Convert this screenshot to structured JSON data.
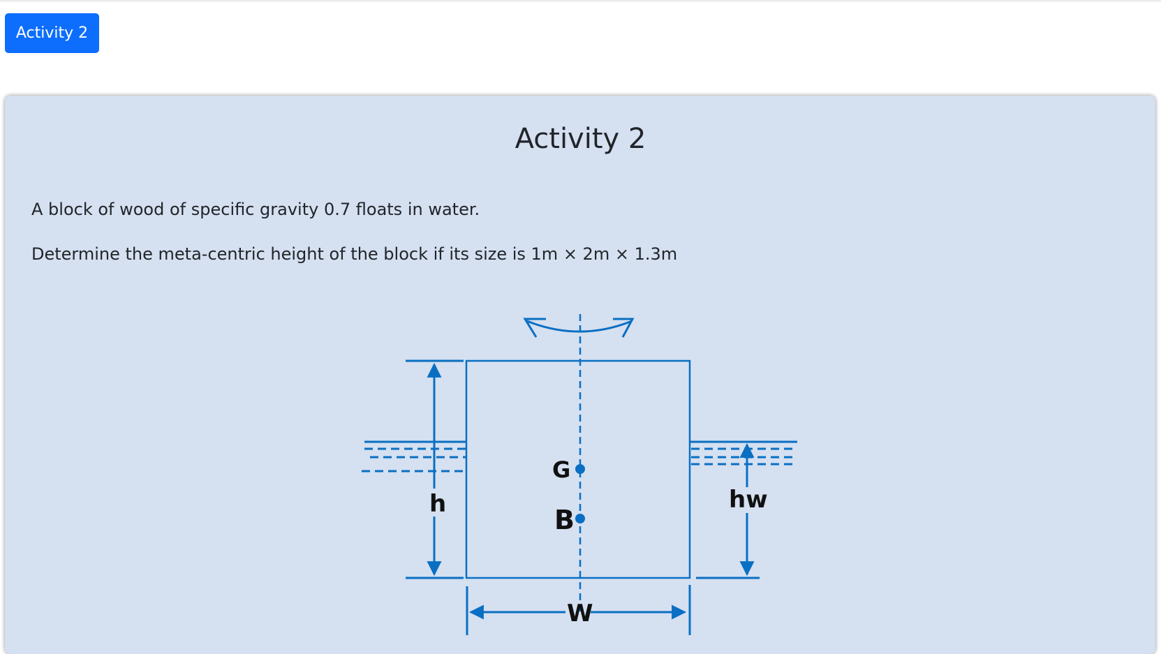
{
  "tab": {
    "label": "Activity 2"
  },
  "card": {
    "title": "Activity 2",
    "paragraphs": [
      "A block of wood of specific gravity 0.7 floats in water.",
      "Determine the meta-centric height of the block if its size is 1m × 2m × 1.3m"
    ]
  },
  "diagram": {
    "labels": {
      "g": "G",
      "b": "B",
      "h": "h",
      "hw": "hw",
      "w": "W"
    },
    "colors": {
      "stroke": "#0a6fc2",
      "label": "#111111"
    }
  }
}
